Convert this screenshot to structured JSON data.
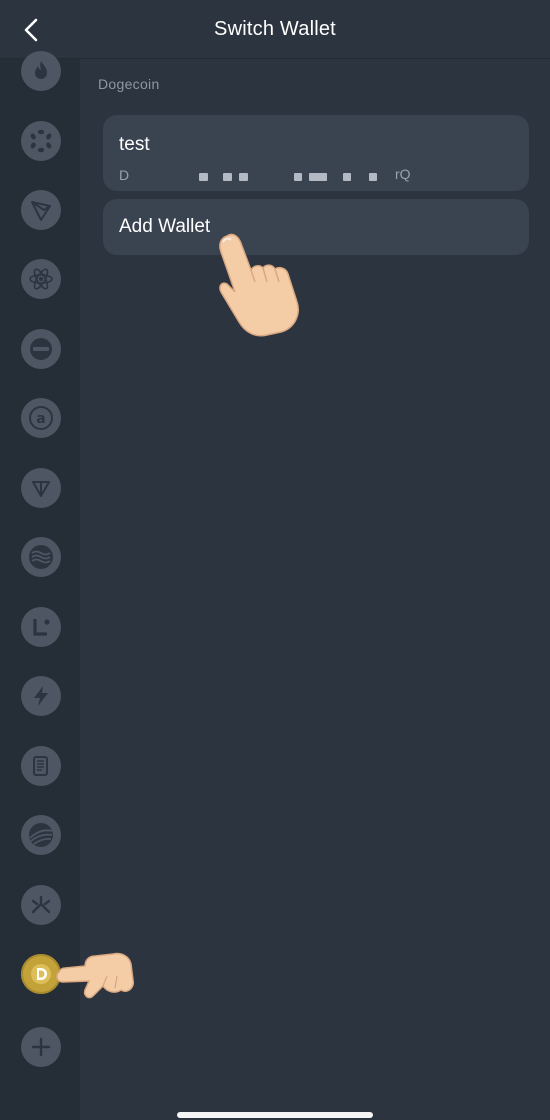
{
  "header": {
    "title": "Switch Wallet",
    "back_icon": "chevron-left-icon"
  },
  "sidebar": {
    "chains": [
      {
        "icon": "flame-icon"
      },
      {
        "icon": "polkadot-icon"
      },
      {
        "icon": "tron-icon"
      },
      {
        "icon": "cosmos-atom-icon"
      },
      {
        "icon": "minus-circle-icon"
      },
      {
        "icon": "at-sign-icon"
      },
      {
        "icon": "ton-triangle-icon"
      },
      {
        "icon": "waves-icon"
      },
      {
        "icon": "l-dot-icon"
      },
      {
        "icon": "lightning-icon"
      },
      {
        "icon": "scroll-icon"
      },
      {
        "icon": "globe-swoosh-icon"
      },
      {
        "icon": "tripod-icon"
      },
      {
        "icon": "dogecoin-icon",
        "selected": true
      },
      {
        "icon": "plus-icon"
      }
    ]
  },
  "main": {
    "section_label": "Dogecoin",
    "wallets": [
      {
        "name": "test",
        "address_prefix": "D",
        "address_suffix": "rQ"
      }
    ],
    "add_wallet_label": "Add Wallet"
  },
  "colors": {
    "background": "#2c3440",
    "sidebar": "#252d37",
    "card": "#3a4350",
    "chain_icon_bg": "#4d5662",
    "dogecoin_gold": "#c4a23a"
  }
}
